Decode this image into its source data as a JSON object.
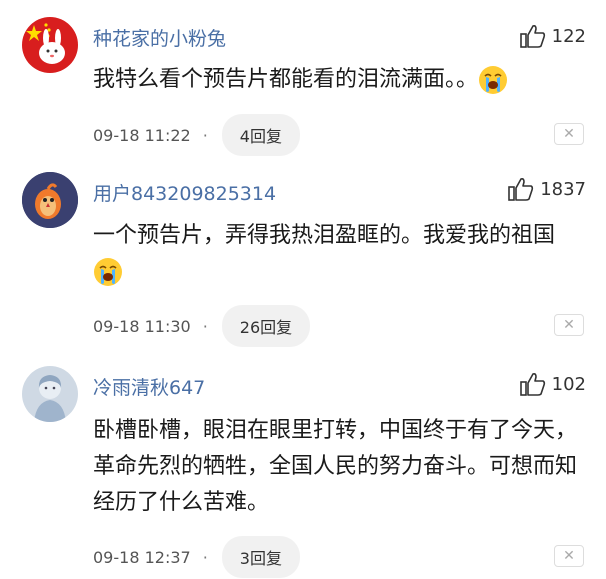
{
  "comments": [
    {
      "username": "种花家的小粉兔",
      "likes": "122",
      "text_before_emoji": "我特么看个预告片都能看的泪流满面。。",
      "text_after_emoji": "",
      "date": "09-18 11:22",
      "replies": "4回复",
      "avatar_icon": "flag-bunny-avatar"
    },
    {
      "username": "用户843209825314",
      "likes": "1837",
      "text_before_emoji": "一个预告片，弄得我热泪盈眶的。我爱我的祖国",
      "text_after_emoji": "",
      "date": "09-18 11:30",
      "replies": "26回复",
      "avatar_icon": "bird-avatar"
    },
    {
      "username": "冷雨清秋647",
      "likes": "102",
      "text_before_emoji": "卧槽卧槽，眼泪在眼里打转，中国终于有了今天，革命先烈的牺牲，全国人民的努力奋斗。可想而知经历了什么苦难。",
      "text_after_emoji": "",
      "date": "09-18 12:37",
      "replies": "3回复",
      "avatar_icon": "girl-avatar"
    }
  ],
  "separator": "·",
  "close_glyph": "✕"
}
